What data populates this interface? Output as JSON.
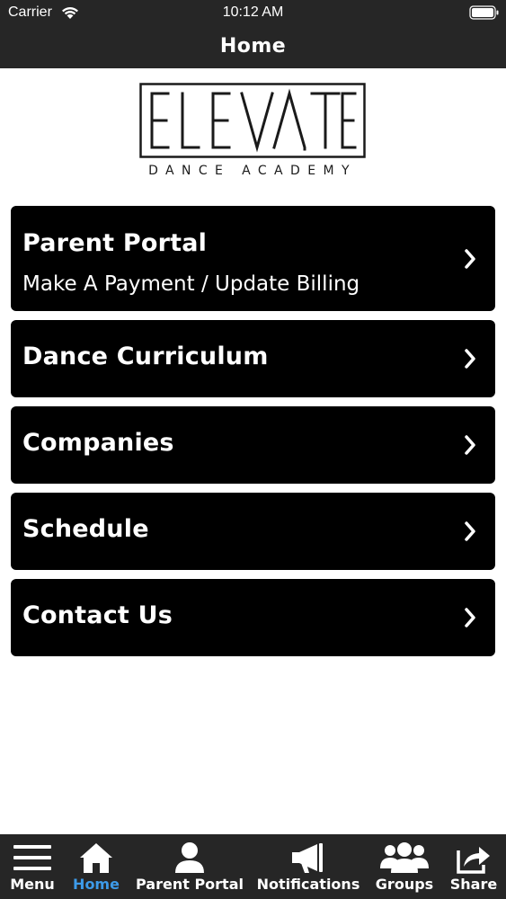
{
  "status_bar": {
    "carrier": "Carrier",
    "time": "10:12 AM"
  },
  "nav": {
    "title": "Home"
  },
  "logo": {
    "wordmark": "ELEVATE",
    "subtitle": "DANCE ACADEMY"
  },
  "menu": {
    "items": [
      {
        "label": "Parent Portal",
        "sublabel": "Make A Payment / Update Billing"
      },
      {
        "label": "Dance Curriculum"
      },
      {
        "label": "Companies"
      },
      {
        "label": "Schedule"
      },
      {
        "label": "Contact Us"
      }
    ]
  },
  "tab_bar": {
    "active": "Home",
    "active_color": "#3d9be9",
    "tabs": [
      {
        "label": "Menu",
        "icon": "hamburger-icon"
      },
      {
        "label": "Home",
        "icon": "home-icon"
      },
      {
        "label": "Parent Portal",
        "icon": "person-icon"
      },
      {
        "label": "Notifications",
        "icon": "megaphone-icon"
      },
      {
        "label": "Groups",
        "icon": "group-icon"
      },
      {
        "label": "Share",
        "icon": "share-icon"
      }
    ]
  },
  "colors": {
    "bar": "#262626",
    "menu_item": "#000000",
    "background": "#ffffff"
  }
}
